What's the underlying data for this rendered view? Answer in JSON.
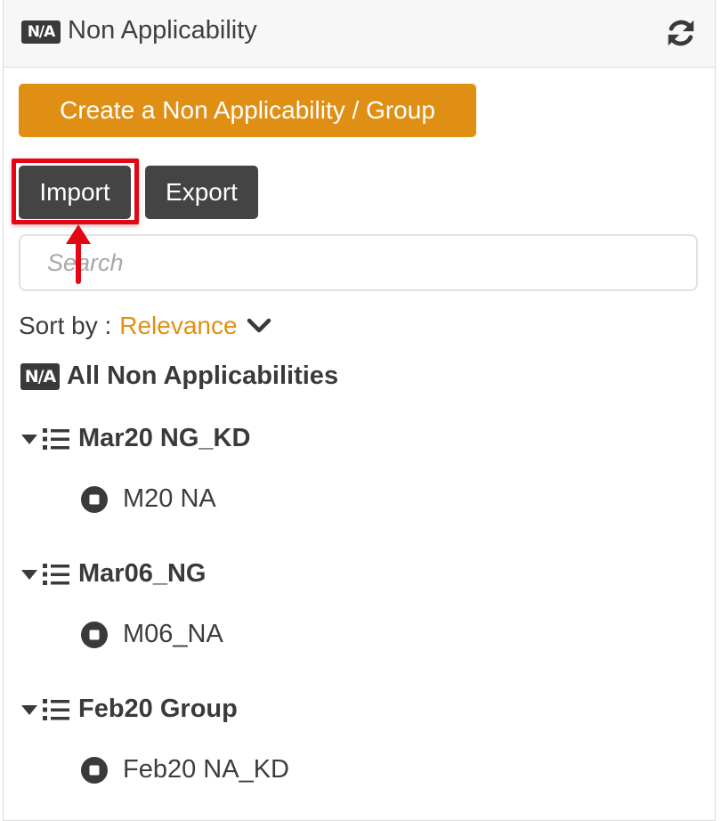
{
  "header": {
    "badge": "N/A",
    "title": "Non Applicability",
    "refresh_icon": "refresh-icon"
  },
  "actions": {
    "create_label": "Create a Non Applicability / Group",
    "import_label": "Import",
    "export_label": "Export"
  },
  "search": {
    "placeholder": "Search",
    "value": ""
  },
  "sort": {
    "label": "Sort by :",
    "value": "Relevance"
  },
  "all_item": {
    "badge": "N/A",
    "label": "All Non Applicabilities"
  },
  "groups": [
    {
      "label": "Mar20 NG_KD",
      "items": [
        {
          "label": "M20 NA"
        }
      ]
    },
    {
      "label": "Mar06_NG",
      "items": [
        {
          "label": "M06_NA"
        }
      ]
    },
    {
      "label": "Feb20 Group",
      "items": [
        {
          "label": "Feb20 NA_KD"
        }
      ]
    }
  ],
  "colors": {
    "accent": "#e08f15",
    "dark_button": "#444444",
    "highlight": "#e30613"
  }
}
